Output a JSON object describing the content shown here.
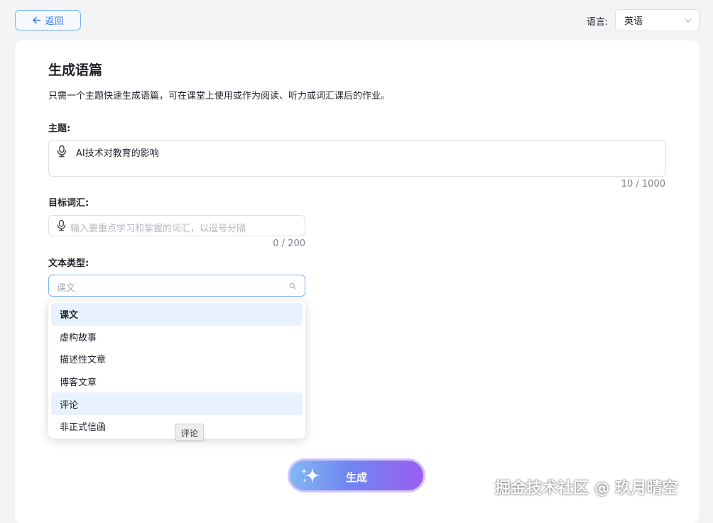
{
  "header": {
    "back_label": "返回",
    "language_label": "语言:",
    "language_value": "英语"
  },
  "form": {
    "title": "生成语篇",
    "description": "只需一个主题快速生成语篇，可在课堂上使用或作为阅读、听力或词汇课后的作业。",
    "topic": {
      "label": "主题:",
      "value": "AI技术对教育的影响",
      "counter": "10 / 1000"
    },
    "vocab": {
      "label": "目标词汇:",
      "placeholder": "输入要重点学习和掌握的词汇，以逗号分隔",
      "counter": "0 / 200"
    },
    "text_type": {
      "label": "文本类型:",
      "placeholder": "课文",
      "options": [
        "课文",
        "虚构故事",
        "描述性文章",
        "博客文章",
        "评论",
        "非正式信函"
      ],
      "selected_index": 0,
      "hover_index": 4,
      "tooltip": "评论"
    },
    "generate_label": "生成"
  },
  "watermark": "掘金技术社区 @ 玖月晴空",
  "colors": {
    "accent": "#3377e6",
    "border": "#dcdfe6",
    "gen_start": "#83b7f3",
    "gen_end": "#9a5ef0"
  },
  "icons": [
    "arrow-left-icon",
    "chevron-down-icon",
    "microphone-icon",
    "search-icon",
    "sparkle-icon"
  ]
}
